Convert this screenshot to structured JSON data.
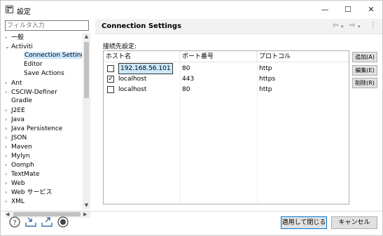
{
  "window": {
    "title": "設定",
    "controls": {
      "minimize": "—",
      "maximize": "☐",
      "close": "✕"
    }
  },
  "left": {
    "filter_placeholder": "フィルタ入力",
    "tree": [
      {
        "label": "一般",
        "twisty": "›",
        "indent": 0,
        "selected": false
      },
      {
        "label": "Activiti",
        "twisty": "⌄",
        "indent": 0,
        "selected": false
      },
      {
        "label": "Connection Settings",
        "twisty": "",
        "indent": 2,
        "selected": true
      },
      {
        "label": "Editor",
        "twisty": "",
        "indent": 2,
        "selected": false
      },
      {
        "label": "Save Actions",
        "twisty": "",
        "indent": 2,
        "selected": false
      },
      {
        "label": "Ant",
        "twisty": "›",
        "indent": 0,
        "selected": false
      },
      {
        "label": "CSCIW-Definer",
        "twisty": "›",
        "indent": 0,
        "selected": false
      },
      {
        "label": "Gradle",
        "twisty": "",
        "indent": 0,
        "selected": false
      },
      {
        "label": "J2EE",
        "twisty": "›",
        "indent": 0,
        "selected": false
      },
      {
        "label": "Java",
        "twisty": "›",
        "indent": 0,
        "selected": false
      },
      {
        "label": "Java Persistence",
        "twisty": "›",
        "indent": 0,
        "selected": false
      },
      {
        "label": "JSON",
        "twisty": "›",
        "indent": 0,
        "selected": false
      },
      {
        "label": "Maven",
        "twisty": "›",
        "indent": 0,
        "selected": false
      },
      {
        "label": "Mylyn",
        "twisty": "›",
        "indent": 0,
        "selected": false
      },
      {
        "label": "Oomph",
        "twisty": "›",
        "indent": 0,
        "selected": false
      },
      {
        "label": "TextMate",
        "twisty": "›",
        "indent": 0,
        "selected": false
      },
      {
        "label": "Web",
        "twisty": "›",
        "indent": 0,
        "selected": false
      },
      {
        "label": "Web サービス",
        "twisty": "›",
        "indent": 0,
        "selected": false
      },
      {
        "label": "XML",
        "twisty": "›",
        "indent": 0,
        "selected": false
      }
    ]
  },
  "page": {
    "title": "Connection Settings",
    "section_label": "接続先設定:",
    "columns": [
      "ホスト名",
      "ポート番号",
      "プロトコル"
    ],
    "rows": [
      {
        "checked": false,
        "host": "192.168.56.101",
        "port": "80",
        "protocol": "http",
        "editing": true
      },
      {
        "checked": true,
        "host": "localhost",
        "port": "443",
        "protocol": "https",
        "editing": false
      },
      {
        "checked": false,
        "host": "localhost",
        "port": "80",
        "protocol": "http",
        "editing": false
      }
    ],
    "buttons": {
      "add": "追加(A)",
      "edit": "編集(E)",
      "remove": "削除(R)"
    }
  },
  "footer": {
    "apply_close": "適用して閉じる",
    "cancel": "キャンセル",
    "icons": [
      "help-icon",
      "import-icon",
      "export-icon",
      "record-icon"
    ]
  }
}
